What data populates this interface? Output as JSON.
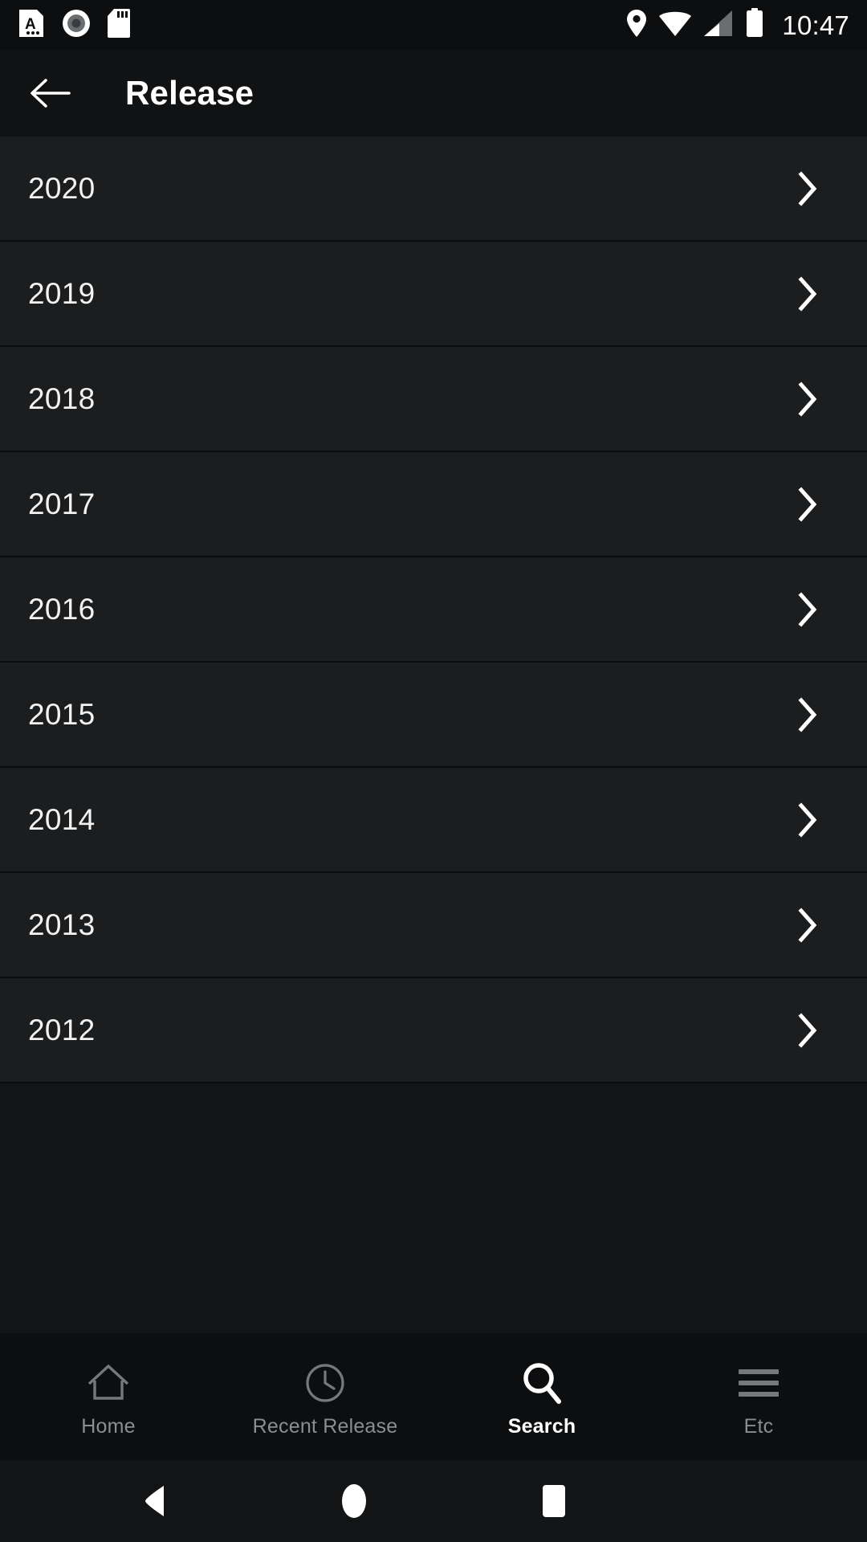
{
  "status_bar": {
    "left_icons": [
      {
        "name": "text-document-icon",
        "label": "A"
      },
      {
        "name": "screen-record-icon",
        "label": ""
      },
      {
        "name": "sd-card-icon",
        "label": ""
      }
    ],
    "right_icons": [
      {
        "name": "location-pin-icon",
        "label": ""
      },
      {
        "name": "wifi-icon",
        "label": ""
      },
      {
        "name": "cellular-signal-icon",
        "label": ""
      },
      {
        "name": "battery-full-icon",
        "label": ""
      }
    ],
    "time": "10:47"
  },
  "app_bar": {
    "back_label": "Back",
    "title": "Release"
  },
  "list": {
    "rows": [
      {
        "label": "2020"
      },
      {
        "label": "2019"
      },
      {
        "label": "2018"
      },
      {
        "label": "2017"
      },
      {
        "label": "2016"
      },
      {
        "label": "2015"
      },
      {
        "label": "2014"
      },
      {
        "label": "2013"
      },
      {
        "label": "2012"
      }
    ]
  },
  "tab_bar": {
    "tabs": [
      {
        "label": "Home",
        "icon": "home-icon",
        "active": false
      },
      {
        "label": "Recent Release",
        "icon": "clock-icon",
        "active": false
      },
      {
        "label": "Search",
        "icon": "search-icon",
        "active": true
      },
      {
        "label": "Etc",
        "icon": "hamburger-menu-icon",
        "active": false
      }
    ]
  },
  "nav_bar": {
    "back": "Back",
    "home": "Home",
    "recents": "Recent apps"
  },
  "colors": {
    "background": "#0d0e10",
    "app_bar": "#111213",
    "row": "#1b1d1f",
    "divider": "#0b0c0d",
    "text_primary": "#f2f2f2",
    "text_inactive": "#8a8e92",
    "accent": "#ffffff"
  }
}
